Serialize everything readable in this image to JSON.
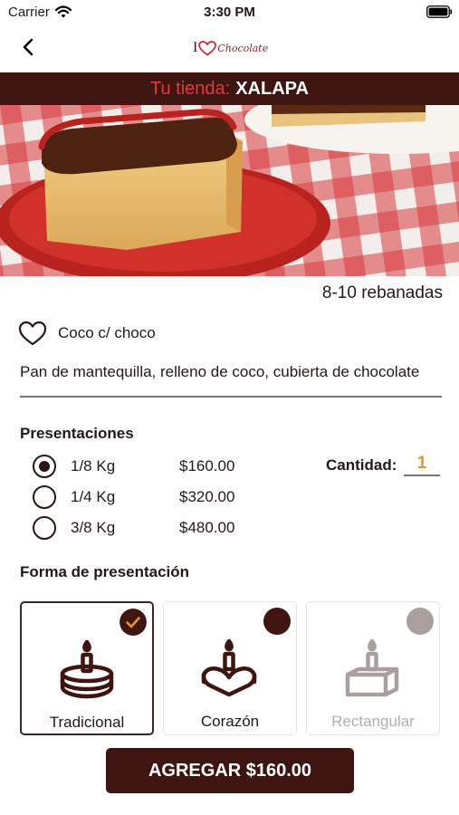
{
  "status_bar": {
    "carrier": "Carrier",
    "time": "3:30 PM"
  },
  "header": {
    "logo": {
      "prefix": "I",
      "word": "Chocolate"
    },
    "back_icon": "chevron-left-icon"
  },
  "store": {
    "label": "Tu tienda:",
    "name": "XALAPA"
  },
  "product": {
    "portion": "8-10 rebanadas",
    "name": "Coco c/ choco",
    "description": "Pan de mantequilla, relleno de coco, cubierta de chocolate",
    "favorite_icon": "heart-outline-icon"
  },
  "presentations": {
    "title": "Presentaciones",
    "options": [
      {
        "size": "1/8 Kg",
        "price": "$160.00",
        "selected": true
      },
      {
        "size": "1/4 Kg",
        "price": "$320.00",
        "selected": false
      },
      {
        "size": "3/8 Kg",
        "price": "$480.00",
        "selected": false
      }
    ],
    "quantity_label": "Cantidad:",
    "quantity_value": "1"
  },
  "shape": {
    "title": "Forma de presentación",
    "options": [
      {
        "label": "Tradicional",
        "selected": true,
        "available": true,
        "icon": "round-cake-icon"
      },
      {
        "label": "Corazón",
        "selected": false,
        "available": true,
        "icon": "heart-cake-icon"
      },
      {
        "label": "Rectangular",
        "selected": false,
        "available": false,
        "icon": "rectangular-cake-icon"
      }
    ]
  },
  "add_button": {
    "label": "AGREGAR $160.00"
  },
  "colors": {
    "brand_dark": "#3f1512",
    "store_label": "#e23a3a",
    "quantity": "#e6961e",
    "disabled": "#a9a09e",
    "disabled_text": "#b3aeac"
  }
}
